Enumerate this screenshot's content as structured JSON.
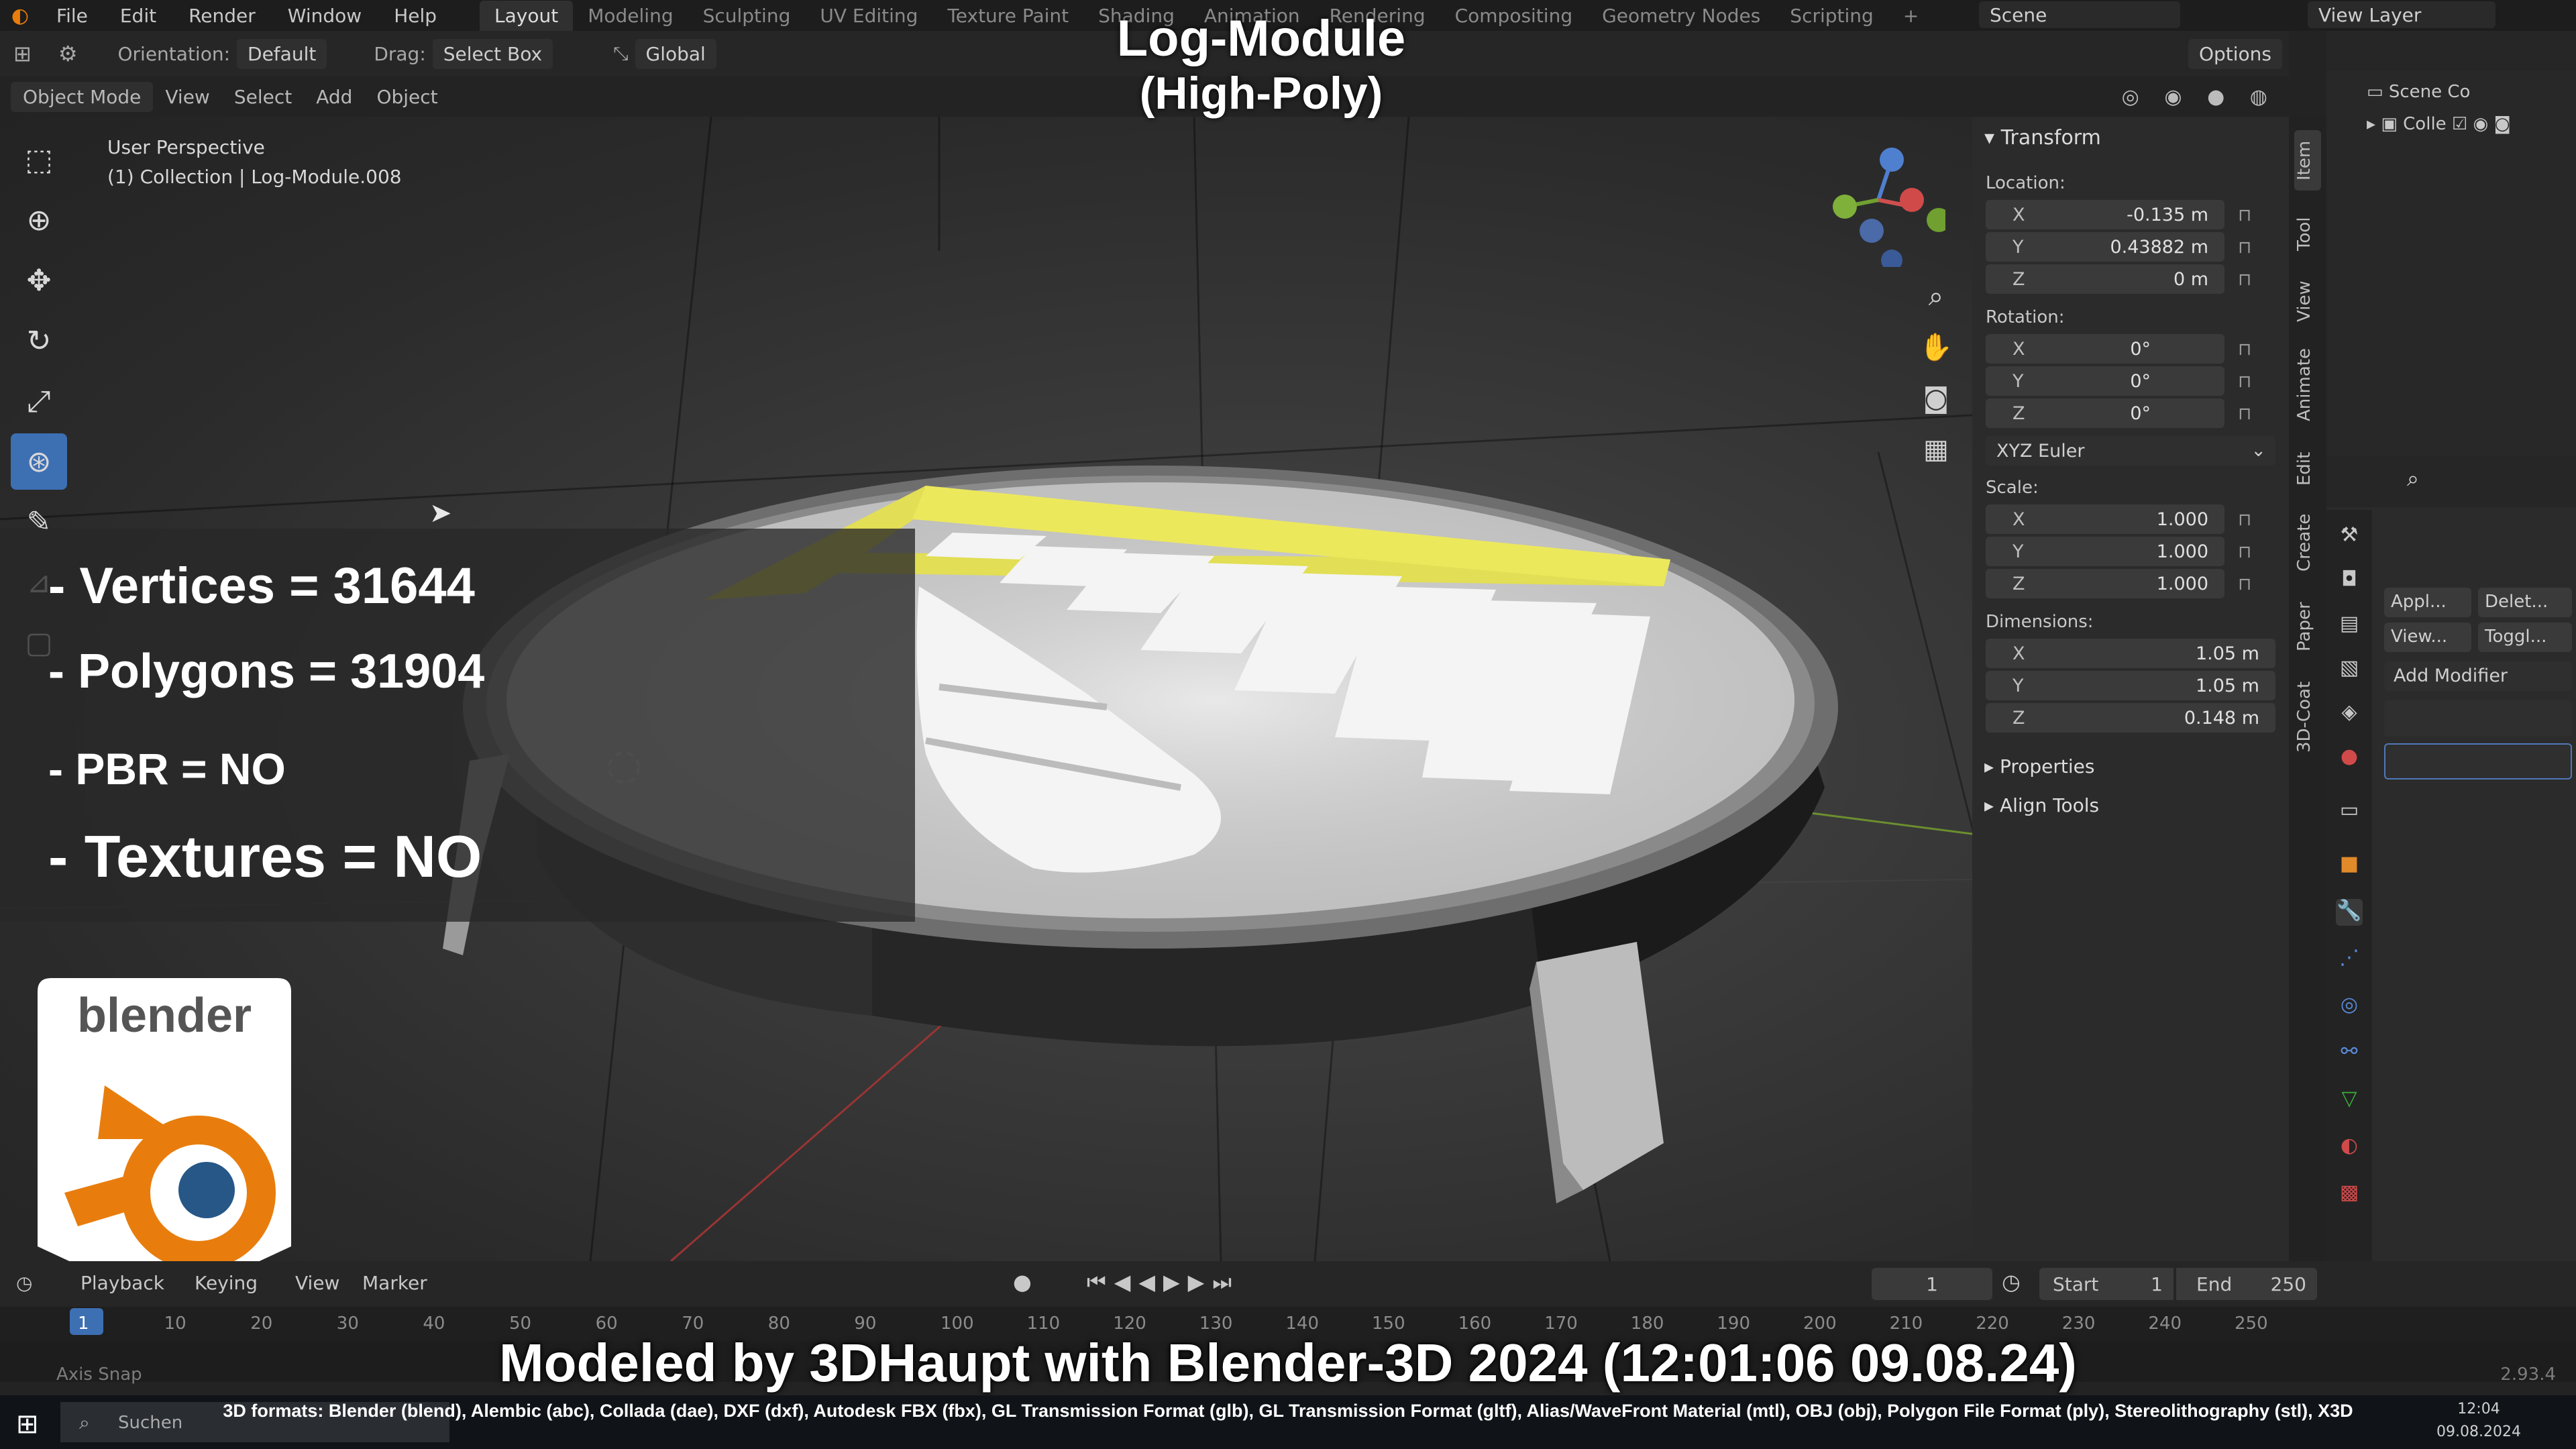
{
  "topbar": {
    "menus": [
      "File",
      "Edit",
      "Render",
      "Window",
      "Help"
    ],
    "workspace_tabs": [
      "Layout",
      "Modeling",
      "Sculpting",
      "UV Editing",
      "Texture Paint",
      "Shading",
      "Animation",
      "Rendering",
      "Compositing",
      "Geometry Nodes",
      "Scripting"
    ],
    "active_tab": "Layout",
    "scene": "Scene",
    "view_layer": "View Layer"
  },
  "header": {
    "orientation_label": "Orientation:",
    "orientation_value": "Default",
    "drag_label": "Drag:",
    "drag_value": "Select Box",
    "transform_space": "Global",
    "options": "Options"
  },
  "subheader": {
    "mode": "Object Mode",
    "menus": [
      "View",
      "Select",
      "Add",
      "Object"
    ]
  },
  "viewport": {
    "perspective": "User Perspective",
    "collection_info": "(1) Collection | Log-Module.008"
  },
  "overlay": {
    "title": "Log-Module",
    "subtitle": "(High-Poly)",
    "vertices": "- Vertices = 31644",
    "polygons": "- Polygons = 31904",
    "pbr": "- PBR =  NO",
    "textures": "- Textures = NO",
    "logo_text": "blender",
    "credit": "Modeled by 3DHaupt with Blender-3D 2024 (12:01:06  09.08.24)",
    "formats": "3D formats: Blender (blend), Alembic (abc), Collada (dae), DXF (dxf), Autodesk FBX (fbx), GL Transmission Format (glb), GL Transmission Format (gltf), Alias/WaveFront Material (mtl), OBJ (obj), Polygon File Format (ply), Stereolithography (stl), X3D"
  },
  "npanel": {
    "transform": "Transform",
    "location_label": "Location:",
    "location": {
      "x": "-0.135 m",
      "y": "0.43882 m",
      "z": "0 m"
    },
    "rotation_label": "Rotation:",
    "rotation": {
      "x": "0°",
      "y": "0°",
      "z": "0°"
    },
    "rotation_mode": "XYZ Euler",
    "scale_label": "Scale:",
    "scale": {
      "x": "1.000",
      "y": "1.000",
      "z": "1.000"
    },
    "dimensions_label": "Dimensions:",
    "dimensions": {
      "x": "1.05 m",
      "y": "1.05 m",
      "z": "0.148 m"
    },
    "properties": "Properties",
    "align_tools": "Align Tools",
    "axes": {
      "x": "X",
      "y": "Y",
      "z": "Z"
    },
    "tabs": [
      "Item",
      "Tool",
      "View",
      "Animate",
      "Edit",
      "Create",
      "Paper",
      "3D-Coat"
    ]
  },
  "outliner": {
    "scene_collection": "Scene Co",
    "collection": "Colle"
  },
  "properties": {
    "apply": "Appl...",
    "delete": "Delet...",
    "view": "View...",
    "toggle": "Toggl...",
    "add_modifier": "Add Modifier"
  },
  "timeline": {
    "playback": "Playback",
    "keying": "Keying",
    "view": "View",
    "marker": "Marker",
    "current_frame": "1",
    "start_label": "Start",
    "start": "1",
    "end_label": "End",
    "end": "250",
    "ticks": [
      "1",
      "10",
      "20",
      "30",
      "40",
      "50",
      "60",
      "70",
      "80",
      "90",
      "100",
      "110",
      "120",
      "130",
      "140",
      "150",
      "160",
      "170",
      "180",
      "190",
      "200",
      "210",
      "220",
      "230",
      "240",
      "250"
    ]
  },
  "statusbar": {
    "axis_snap": "Axis Snap",
    "version": "2.93.4"
  },
  "taskbar": {
    "search": "Suchen",
    "time": "12:04",
    "date": "09.08.2024"
  }
}
